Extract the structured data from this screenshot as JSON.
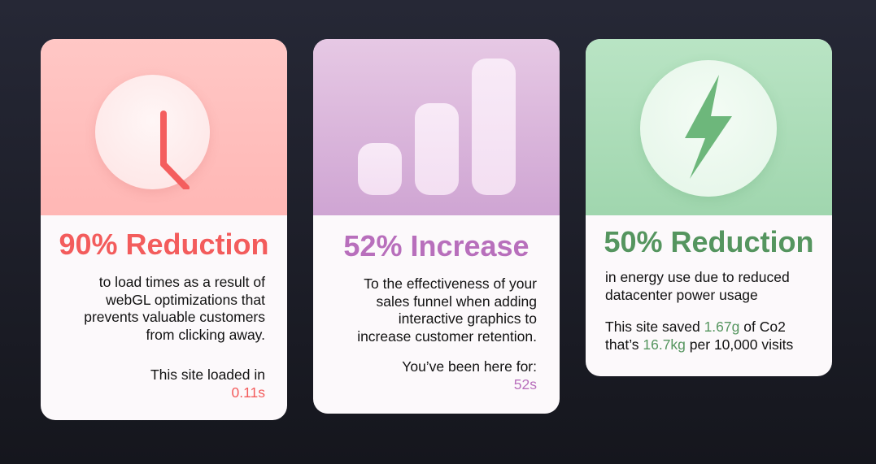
{
  "cards": [
    {
      "icon": "clock-icon",
      "title": "90% Reduction",
      "description_lines": [
        "to load times as a result of",
        "webGL optimizations that",
        "prevents valuable customers",
        "from clicking away."
      ],
      "stat_label": "This site loaded in",
      "stat_value": "0.11s",
      "colors": {
        "accent": "#f35c5c",
        "top_bg": "#ffbfbd"
      }
    },
    {
      "icon": "bar-chart-icon",
      "title": "52% Increase",
      "description_lines": [
        "To the effectiveness of your",
        "sales funnel when adding",
        "interactive graphics to",
        "increase customer retention."
      ],
      "stat_label": "You’ve been here for:",
      "stat_value": "52s",
      "colors": {
        "accent": "#b86fbc",
        "top_bg": "#dbb7dc"
      }
    },
    {
      "icon": "lightning-bolt-icon",
      "title": "50% Reduction",
      "description_lines": [
        "in energy use due to reduced",
        "datacenter power usage"
      ],
      "savings_line_1": {
        "prefix": "This site saved ",
        "value": "1.67g",
        "suffix": " of Co2"
      },
      "savings_line_2": {
        "prefix": "that’s ",
        "value": "16.7kg",
        "suffix": " per 10,000 visits"
      },
      "colors": {
        "accent": "#55955f",
        "top_bg": "#aedcb9"
      }
    }
  ]
}
